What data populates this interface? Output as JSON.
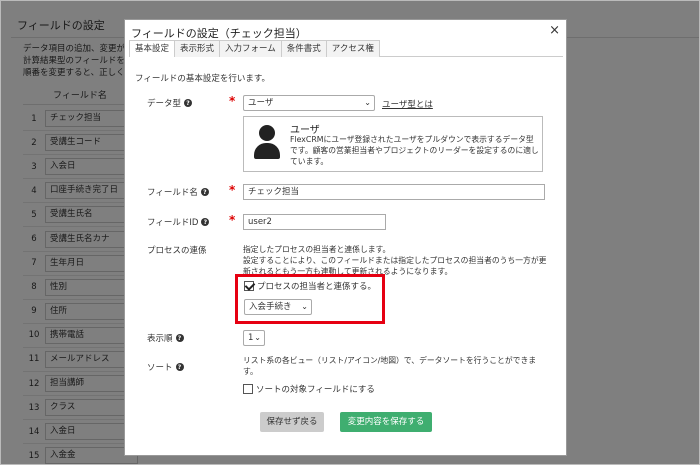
{
  "background": {
    "title": "フィールドの設定",
    "desc_lines": [
      "データ項目の追加、変更が可",
      "計算結果型のフィールドを利",
      "順番を変更すると、正しく計"
    ],
    "column_header": "フィールド名",
    "rows": [
      {
        "num": "1",
        "name": "チェック担当"
      },
      {
        "num": "2",
        "name": "受講生コード"
      },
      {
        "num": "3",
        "name": "入会日"
      },
      {
        "num": "4",
        "name": "口座手続き完了日"
      },
      {
        "num": "5",
        "name": "受講生氏名"
      },
      {
        "num": "6",
        "name": "受講生氏名カナ"
      },
      {
        "num": "7",
        "name": "生年月日"
      },
      {
        "num": "8",
        "name": "性別"
      },
      {
        "num": "9",
        "name": "住所"
      },
      {
        "num": "10",
        "name": "携帯電話"
      },
      {
        "num": "11",
        "name": "メールアドレス"
      },
      {
        "num": "12",
        "name": "担当講師"
      },
      {
        "num": "13",
        "name": "クラス"
      },
      {
        "num": "14",
        "name": "入金日"
      },
      {
        "num": "15",
        "name": "入金金"
      }
    ]
  },
  "dialog": {
    "title": "フィールドの設定（チェック担当）",
    "close": "×",
    "tabs": [
      "基本設定",
      "表示形式",
      "入力フォーム",
      "条件書式",
      "アクセス権"
    ],
    "intro": "フィールドの基本設定を行います。",
    "datatype": {
      "label": "データ型",
      "value": "ユーザ",
      "link": "ユーザ型とは",
      "info_title": "ユーザ",
      "info_desc": "FlexCRMにユーザ登録されたユーザをプルダウンで表示するデータ型です。顧客の営業担当者やプロジェクトのリーダーを設定するのに適しています。"
    },
    "field_name": {
      "label": "フィールド名",
      "value": "チェック担当"
    },
    "field_id": {
      "label": "フィールドID",
      "value": "user2"
    },
    "process": {
      "label": "プロセスの連係",
      "desc1": "指定したプロセスの担当者と連係します。",
      "desc2": "設定することにより、このフィールドまたは指定したプロセスの担当者のうち一方が更新されるともう一方も連動して更新されるようになります。",
      "checkbox_label": "プロセスの担当者と連係する。",
      "checked": true,
      "select_value": "入会手続き"
    },
    "order": {
      "label": "表示順",
      "value": "1"
    },
    "sort": {
      "label": "ソート",
      "desc": "リスト系の各ビュー（リスト/アイコン/地図）で、データソートを行うことができます。",
      "checkbox_label": "ソートの対象フィールドにする",
      "checked": false
    },
    "buttons": {
      "cancel": "保存せず戻る",
      "save": "変更内容を保存する"
    },
    "colors": {
      "accent_green": "#3fae70",
      "highlight_red": "#e60012",
      "required_red": "#dd0000"
    }
  }
}
